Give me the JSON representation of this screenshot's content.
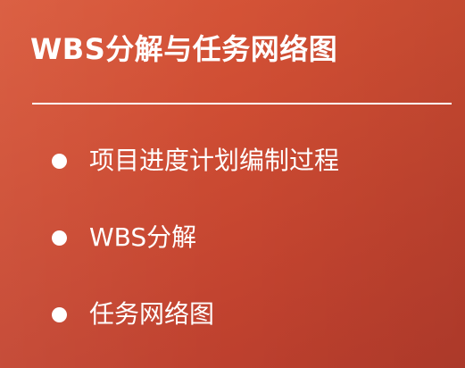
{
  "slide": {
    "title": "WBS分解与任务网络图",
    "background_color": "#c9472f",
    "text_color": "#ffffff"
  },
  "bullets": [
    {
      "label": "项目进度计划编制过程"
    },
    {
      "label": "WBS分解"
    },
    {
      "label": "任务网络图"
    }
  ]
}
